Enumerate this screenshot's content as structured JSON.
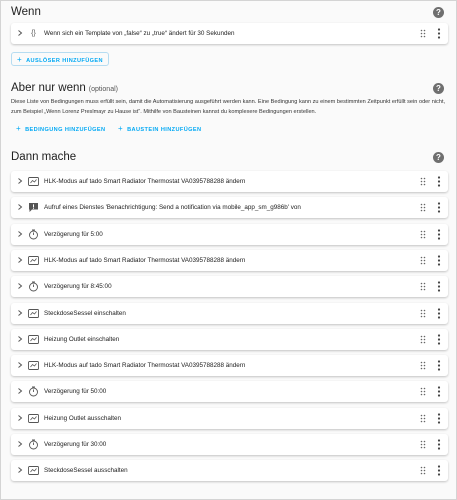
{
  "wenn": {
    "title": "Wenn",
    "trigger_label": "Wenn sich ein Template von „false“ zu „true“ ändert für 30 Sekunden",
    "add_button": "AUSLÖSER HINZUFÜGEN"
  },
  "aber": {
    "title": "Aber nur wenn",
    "optional": "(optional)",
    "description": "Diese Liste von Bedingungen muss erfüllt sein, damit die Automatisierung ausgeführt werden kann. Eine Bedingung kann zu einem bestimmten Zeitpunkt erfüllt sein oder nicht, zum Beispiel „Wenn Lorenz Preslmayr zu Hause ist“. Mithilfe von Bausteinen kannst du komplexere Bedingungen erstellen.",
    "add_condition": "BEDINGUNG HINZUFÜGEN",
    "add_block": "BAUSTEIN HINZUFÜGEN"
  },
  "dann": {
    "title": "Dann mache",
    "actions": [
      {
        "icon": "thermostat-icon",
        "label": "HLK-Modus auf tado Smart Radiator Thermostat VA0395788288 ändern"
      },
      {
        "icon": "notification-icon",
        "label": "Aufruf eines Dienstes 'Benachrichtigung: Send a notification via mobile_app_sm_g986b' von"
      },
      {
        "icon": "timer-icon",
        "label": "Verzögerung für 5:00"
      },
      {
        "icon": "thermostat-icon",
        "label": "HLK-Modus auf tado Smart Radiator Thermostat VA0395788288 ändern"
      },
      {
        "icon": "timer-icon",
        "label": "Verzögerung für 8:45:00"
      },
      {
        "icon": "device-icon",
        "label": "SteckdoseSessel einschalten"
      },
      {
        "icon": "device-icon",
        "label": "Heizung Outlet einschalten"
      },
      {
        "icon": "thermostat-icon",
        "label": "HLK-Modus auf tado Smart Radiator Thermostat VA0395788288 ändern"
      },
      {
        "icon": "timer-icon",
        "label": "Verzögerung für 50:00"
      },
      {
        "icon": "device-icon",
        "label": "Heizung Outlet ausschalten"
      },
      {
        "icon": "timer-icon",
        "label": "Verzögerung für 30:00"
      },
      {
        "icon": "device-icon",
        "label": "SteckdoseSessel ausschalten"
      }
    ]
  },
  "help_glyph": "?",
  "colors": {
    "accent": "#03a9f4",
    "icon": "#555555",
    "background": "#fafafa"
  }
}
